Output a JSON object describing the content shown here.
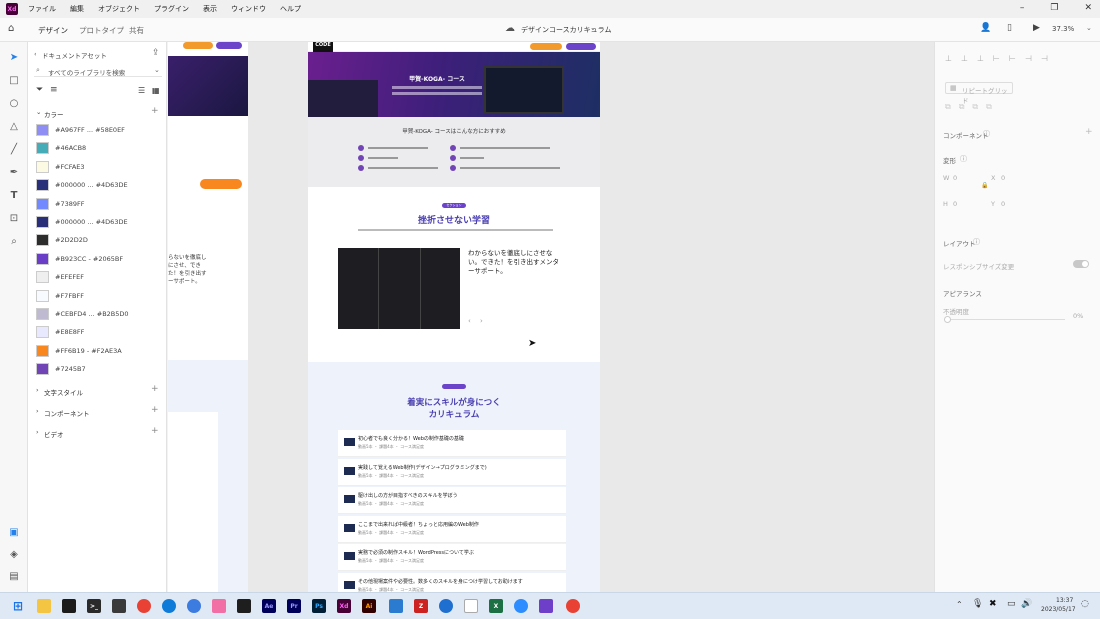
{
  "app": {
    "name": "Xd",
    "document_title": "デザインコースカリキュラム",
    "zoom": "37.3%"
  },
  "menu": [
    "ファイル",
    "編集",
    "オブジェクト",
    "プラグイン",
    "表示",
    "ウィンドウ",
    "ヘルプ"
  ],
  "mode_tabs": [
    "デザイン",
    "プロトタイプ",
    "共有"
  ],
  "assets": {
    "header": "ドキュメントアセット",
    "search_placeholder": "すべてのライブラリを検索",
    "colors_heading": "カラー",
    "colors": [
      {
        "label": "#A967FF ... #58E0EF",
        "color": "#8f8ef5"
      },
      {
        "label": "#46ACB8",
        "color": "#46acb8"
      },
      {
        "label": "#FCFAE3",
        "color": "#fcfae3"
      },
      {
        "label": "#000000 ... #4D63DE",
        "color": "#2a2f7a"
      },
      {
        "label": "#7389FF",
        "color": "#7389ff"
      },
      {
        "label": "#000000 ... #4D63DE",
        "color": "#2a2f7a"
      },
      {
        "label": "#2D2D2D",
        "color": "#2d2d2d"
      },
      {
        "label": "#B923CC - #2065BF",
        "color": "#6a3ec6"
      },
      {
        "label": "#EFEFEF",
        "color": "#efefef"
      },
      {
        "label": "#F7FBFF",
        "color": "#f7fbff"
      },
      {
        "label": "#CEBFD4 ... #B2B5D0",
        "color": "#bfb9d2"
      },
      {
        "label": "#E8E8FF",
        "color": "#e8e8ff"
      },
      {
        "label": "#FF6B19 - #F2AE3A",
        "color": "#f8871f"
      },
      {
        "label": "#7245B7",
        "color": "#7245b7"
      }
    ],
    "sections": [
      "文字スタイル",
      "コンポーネント",
      "ビデオ"
    ]
  },
  "right_panel": {
    "repeat_grid": "リピートグリッド",
    "component": "コンポーネント",
    "transform": "変形",
    "w_label": "W",
    "w_value": "0",
    "h_label": "H",
    "h_value": "0",
    "x_label": "X",
    "x_value": "0",
    "y_label": "Y",
    "y_value": "0",
    "layout": "レイアウト",
    "responsive": "レスポンシブサイズ変更",
    "appearance": "アピアランス",
    "opacity_label": "不透明度",
    "opacity_value": "0%"
  },
  "artboard": {
    "hero_title": "甲賀-KOGA- コース",
    "recommend_title": "甲賀-KOGA- コースはこんな方におすすめ",
    "section_badge": "セクション",
    "section_title": "挫折させない学習",
    "feature_text": "わからないを徹底しにさせない。できた！を引き出すメンターサポート。",
    "curriculum_title_1": "着実にスキルが身につく",
    "curriculum_title_2": "カリキュラム",
    "side_text": "らないを徹底しにさせ、できた！を引き出すーサポート。",
    "courses": [
      {
        "title": "初心者でも良く分かる！Webの制作基礎の基礎",
        "sub": "動画5本 ・ 課題4本 ・ コース満足度"
      },
      {
        "title": "実践して覚えるWeb制作(デザイン→プログラミングまで)",
        "sub": "動画5本 ・ 課題4本 ・ コース満足度"
      },
      {
        "title": "駆け出しの方が目指すべきのスキルを学ぼう",
        "sub": "動画5本 ・ 課題4本 ・ コース満足度"
      },
      {
        "title": "ここまで出来れば中級者！ちょっと応用編のWeb制作",
        "sub": "動画5本 ・ 課題4本 ・ コース満足度"
      },
      {
        "title": "実務で必須の制作スキル！WordPressについて学ぶ",
        "sub": "動画5本 ・ 課題4本 ・ コース満足度"
      },
      {
        "title": "その他現場案件や必要性。数多くのスキルを身につけ学習してお助けます",
        "sub": "動画5本 ・ 課題4本 ・ コース満足度"
      }
    ]
  },
  "taskbar": {
    "time": "13:37",
    "date": "2023/05/17"
  }
}
